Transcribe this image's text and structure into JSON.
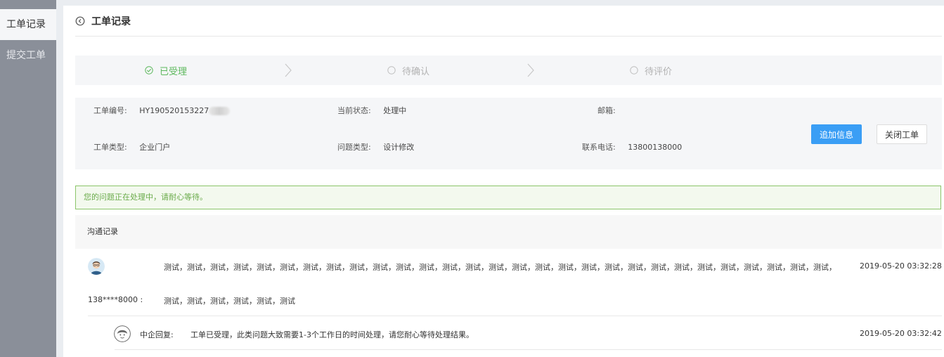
{
  "sidebar": {
    "items": [
      {
        "label": "工单记录"
      },
      {
        "label": "提交工单"
      }
    ]
  },
  "header": {
    "title": "工单记录"
  },
  "steps": [
    {
      "label": "已受理",
      "state": "done"
    },
    {
      "label": "待确认",
      "state": "todo"
    },
    {
      "label": "待评价",
      "state": "todo"
    }
  ],
  "info": {
    "ticket_no_label": "工单编号:",
    "ticket_no_value": "HY190520153227",
    "status_label": "当前状态:",
    "status_value": "处理中",
    "email_label": "邮箱:",
    "email_value": "",
    "type_label": "工单类型:",
    "type_value": "企业门户",
    "problem_label": "问题类型:",
    "problem_value": "设计修改",
    "phone_label": "联系电话:",
    "phone_value": "13800138000",
    "add_info_button": "追加信息",
    "close_ticket_button": "关闭工单"
  },
  "notice": {
    "text": "您的问题正在处理中，请耐心等待。"
  },
  "records": {
    "title": "沟通记录",
    "user_message": {
      "sender": "138****8000 :",
      "line1": "测试，测试，测试，测试，测试，测试，测试，测试，测试，测试，测试，测试，测试，测试，测试，测试，测试，测试，测试，测试，测试，测试，测试，测试，测试，测试，测试，测试，测试，",
      "line2": "测试，测试，测试，测试，测试，测试",
      "time": "2019-05-20 03:32:28"
    },
    "reply": {
      "sender": "中企回复:",
      "text": "工单已受理，此类问题大致需要1-3个工作日的时间处理，请您耐心等待处理结果。",
      "time": "2019-05-20 03:32:42"
    }
  },
  "colors": {
    "primary": "#3a9ef5",
    "success": "#5cb85c",
    "sidebar": "#8a8f99"
  }
}
